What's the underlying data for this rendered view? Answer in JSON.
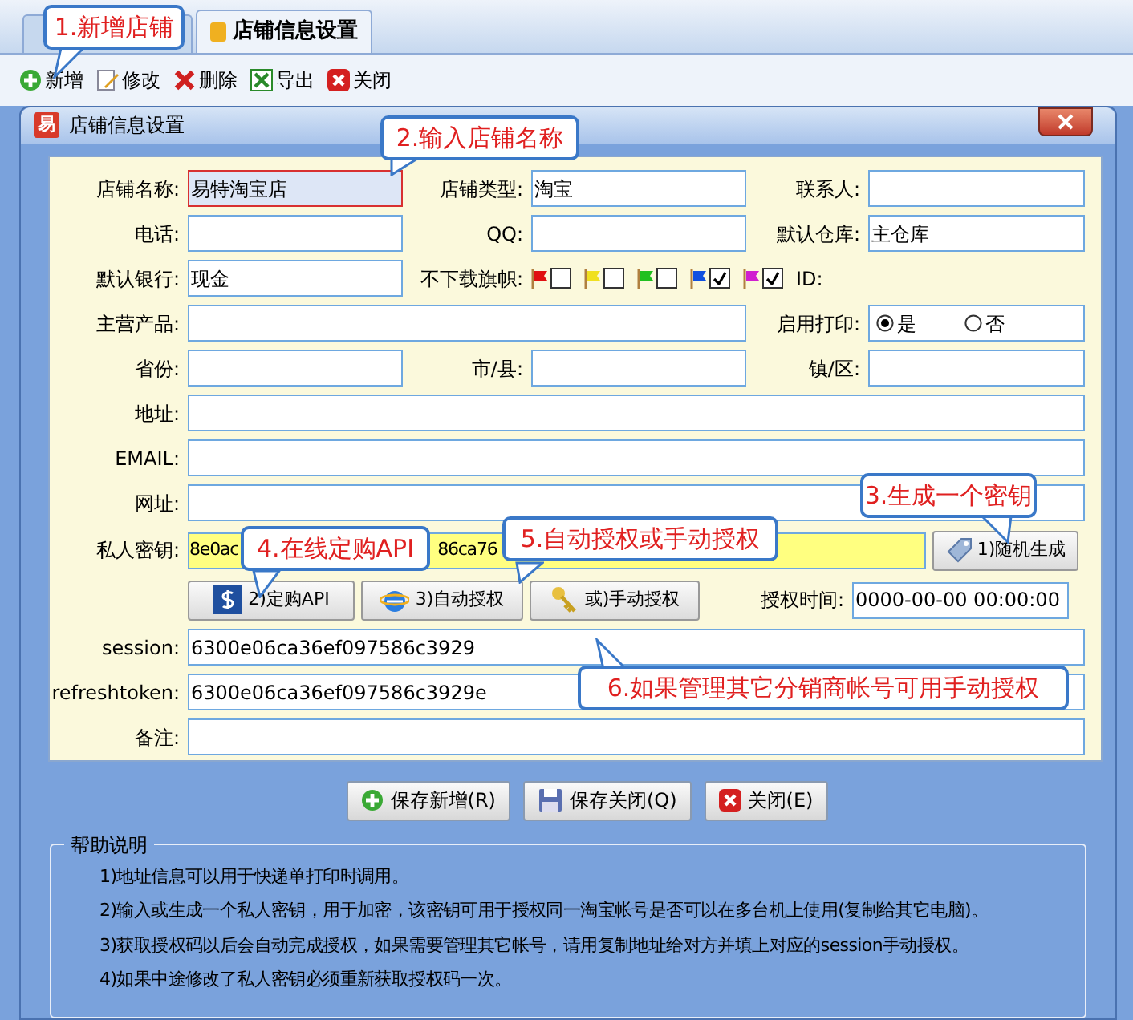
{
  "tabs": [
    {
      "selected": false
    },
    {
      "label": "店铺信息设置",
      "selected": true
    }
  ],
  "toolbar": [
    {
      "label": "新增"
    },
    {
      "label": "修改"
    },
    {
      "label": "删除"
    },
    {
      "label": "导出"
    },
    {
      "label": "关闭"
    }
  ],
  "dialog": {
    "title": "店铺信息设置",
    "logo_text": "易",
    "rows": [
      {
        "kind": "triple",
        "pairs": [
          {
            "label": "店铺名称:",
            "value": "易特淘宝店",
            "focused": true
          },
          {
            "label": "店铺类型:",
            "value": "淘宝",
            "focused": false
          },
          {
            "label": "联系人:",
            "focused": false
          }
        ]
      },
      {
        "kind": "triple",
        "pairs": [
          {
            "label": "电话:",
            "focused": false
          },
          {
            "label": "QQ:",
            "focused": false
          },
          {
            "label": "默认仓库:",
            "value": "主仓库",
            "focused": false
          }
        ]
      },
      {
        "kind": "flags",
        "label": "默认银行:",
        "value": "现金",
        "flags_label": "不下载旗帜:",
        "flags": [
          {
            "color": "#e01010",
            "checked": false
          },
          {
            "color": "#f0e020",
            "checked": false
          },
          {
            "color": "#20c020",
            "checked": false
          },
          {
            "color": "#1050e0",
            "checked": true
          },
          {
            "color": "#d020d0",
            "checked": true
          }
        ],
        "id_label": "ID:"
      },
      {
        "kind": "product",
        "label": "主营产品:",
        "print_label": "启用打印:",
        "options": [
          {
            "label": "是",
            "selected": true
          },
          {
            "label": "否",
            "selected": false
          }
        ]
      },
      {
        "kind": "triple",
        "pairs": [
          {
            "label": "省份:",
            "focused": false
          },
          {
            "label": "市/县:",
            "focused": false
          },
          {
            "label": "镇/区:",
            "focused": false
          }
        ]
      },
      {
        "kind": "wide",
        "label": "地址:"
      },
      {
        "kind": "wide",
        "label": "EMAIL:"
      },
      {
        "kind": "wide",
        "label": "网址:"
      },
      {
        "kind": "key",
        "label": "私人密钥:",
        "value_parts": [
          "8e0ac",
          "86ca76"
        ],
        "button": "1)随机生成"
      },
      {
        "kind": "auth",
        "buttons": [
          {
            "label": "2)定购API"
          },
          {
            "label": "3)自动授权"
          },
          {
            "label": "或)手动授权"
          }
        ],
        "label": "授权时间:",
        "value": "0000-00-00 00:00:00"
      },
      {
        "kind": "wide",
        "label": "session:",
        "value": "6300e06ca36ef097586c3929"
      },
      {
        "kind": "wide",
        "label": "refreshtoken:",
        "value": "6300e06ca36ef097586c3929e"
      },
      {
        "kind": "wide",
        "label": "备注:"
      }
    ],
    "buttons": [
      {
        "label": "保存新增(R)"
      },
      {
        "label": "保存关闭(Q)"
      },
      {
        "label": "关闭(E)"
      }
    ],
    "help": {
      "title": "帮助说明",
      "lines": [
        "1)地址信息可以用于快递单打印时调用。",
        "2)输入或生成一个私人密钥，用于加密，该密钥可用于授权同一淘宝帐号是否可以在多台机上使用(复制给其它电脑)。",
        "3)获取授权码以后会自动完成授权，如果需要管理其它帐号，请用复制地址给对方并填上对应的session手动授权。",
        "4)如果中途修改了私人密钥必须重新获取授权码一次。"
      ]
    }
  },
  "callouts": [
    "1.新增店铺",
    "2.输入店铺名称",
    "3.生成一个密钥",
    "4.在线定购API",
    "5.自动授权或手动授权",
    "6.如果管理其它分销商帐号可用手动授权"
  ]
}
